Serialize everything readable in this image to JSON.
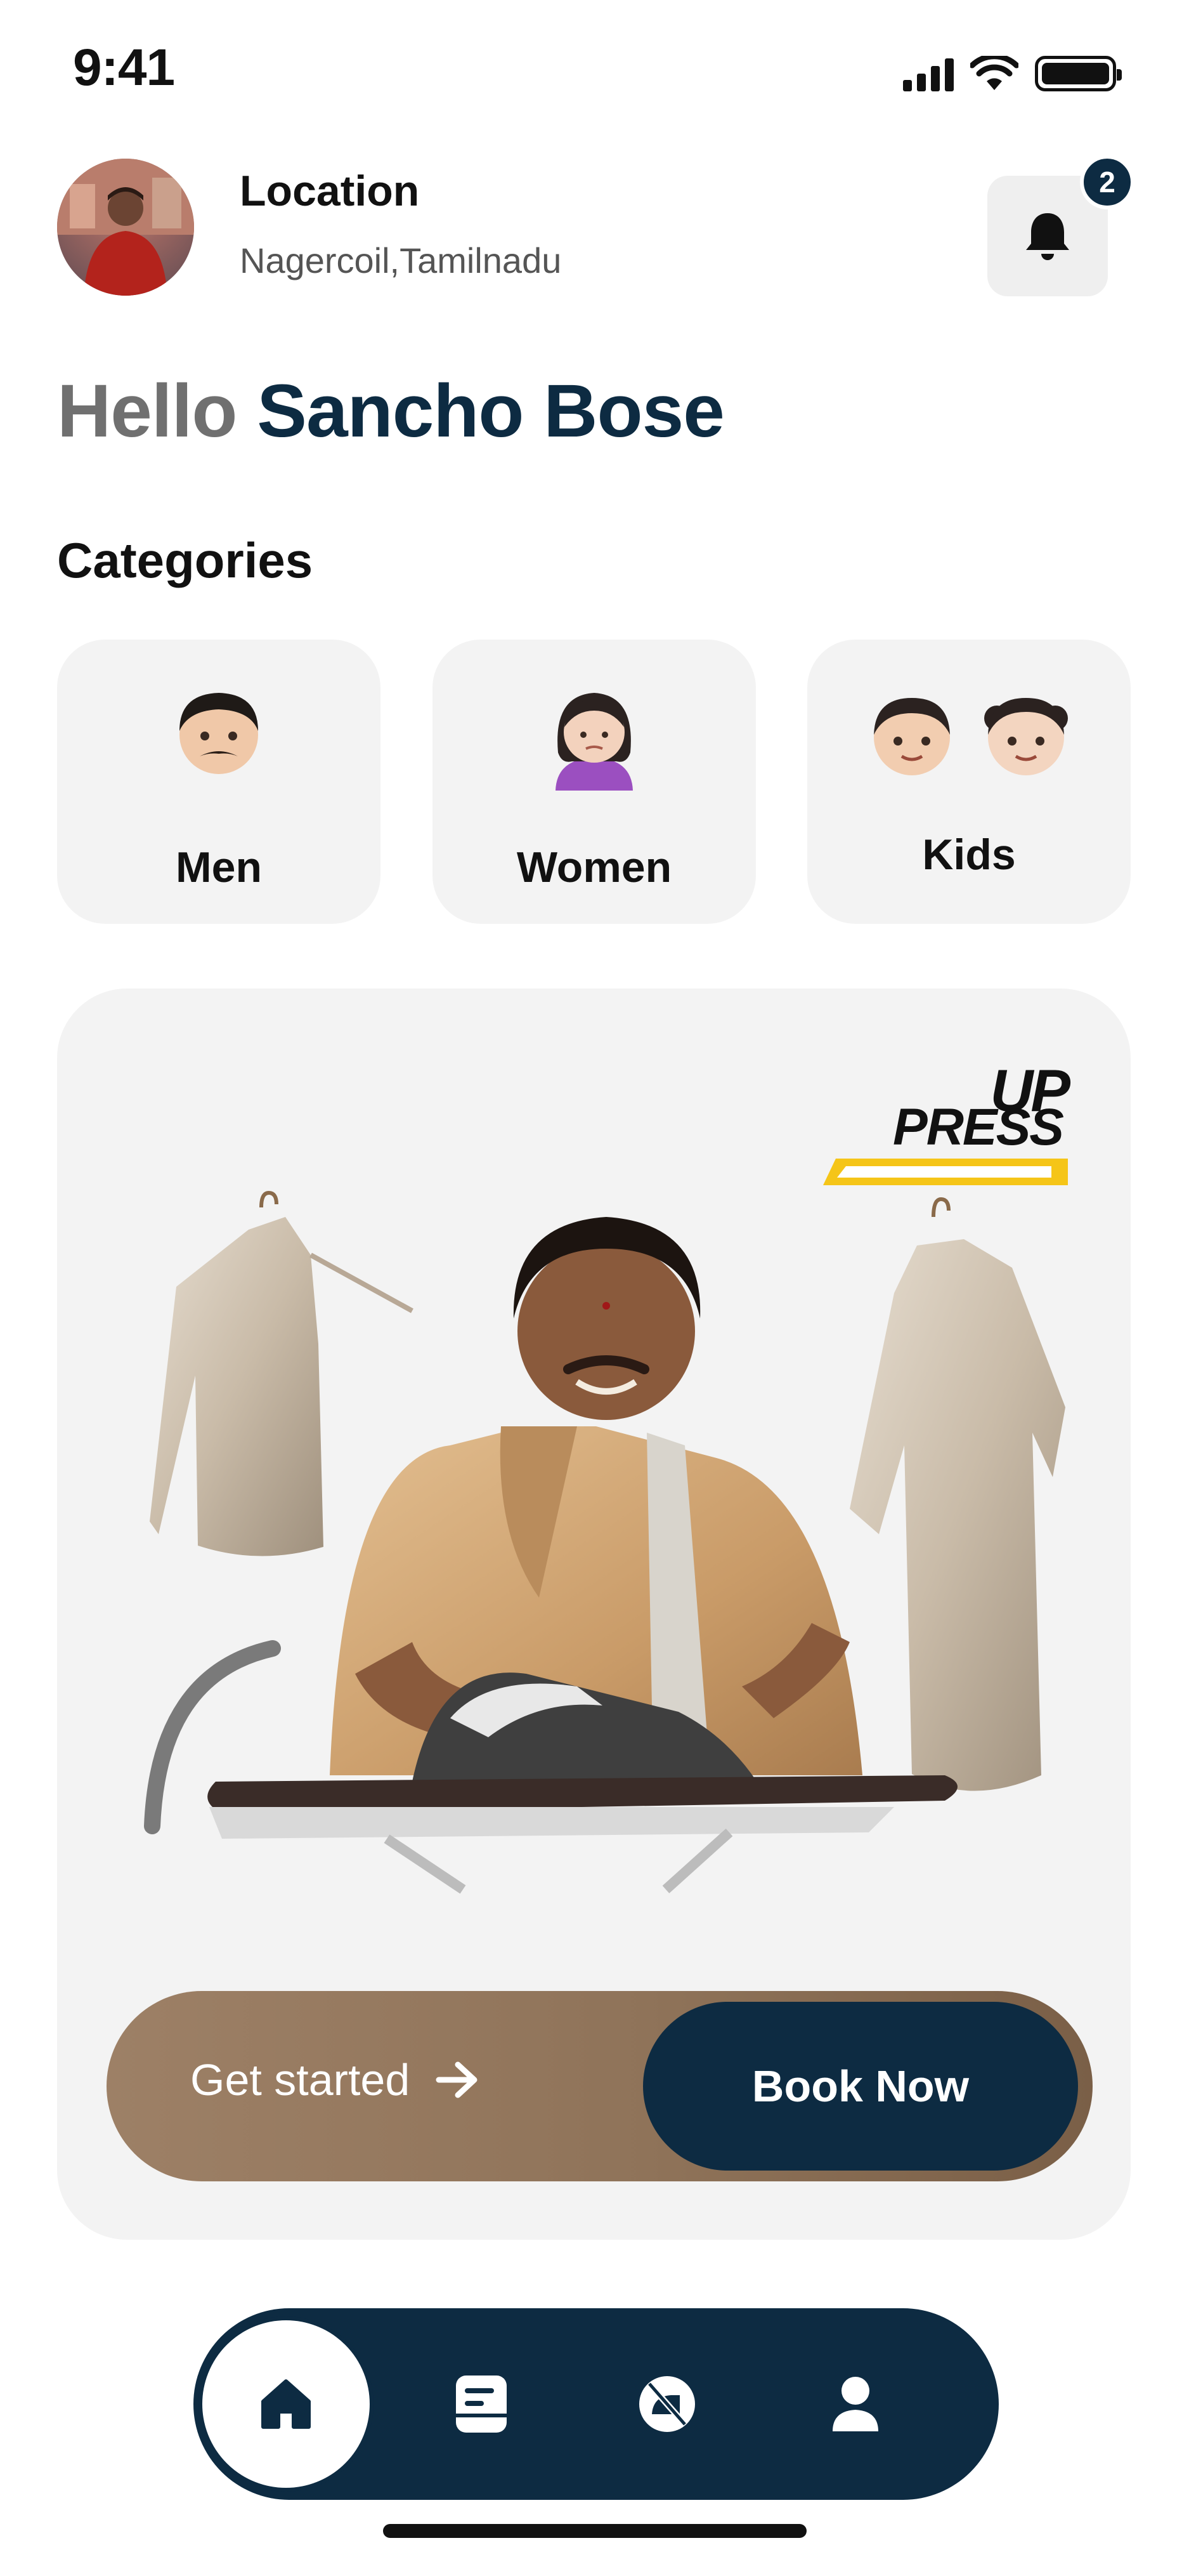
{
  "status_bar": {
    "time": "9:41"
  },
  "header": {
    "location_title": "Location",
    "location_value": "Nagercoil,Tamilnadu",
    "notification_count": "2"
  },
  "greeting": {
    "hello": "Hello",
    "name": "Sancho Bose"
  },
  "categories": {
    "title": "Categories",
    "items": [
      {
        "label": "Men",
        "icon": "man-emoji"
      },
      {
        "label": "Women",
        "icon": "woman-emoji"
      },
      {
        "label": "Kids",
        "icon": "kids-emoji"
      }
    ]
  },
  "banner": {
    "logo_line1": "UP",
    "logo_line2": "PRESS",
    "cta_primary": "Get started",
    "cta_secondary": "Book Now"
  },
  "nav": {
    "tabs": [
      {
        "icon": "home-icon",
        "active": true
      },
      {
        "icon": "orders-icon",
        "active": false
      },
      {
        "icon": "no-ironing-icon",
        "active": false
      },
      {
        "icon": "profile-icon",
        "active": false
      }
    ]
  },
  "colors": {
    "primary": "#0d2b42",
    "accent_yellow": "#f5c518",
    "card_bg": "#f3f3f3",
    "cta_brown": "#957860"
  }
}
